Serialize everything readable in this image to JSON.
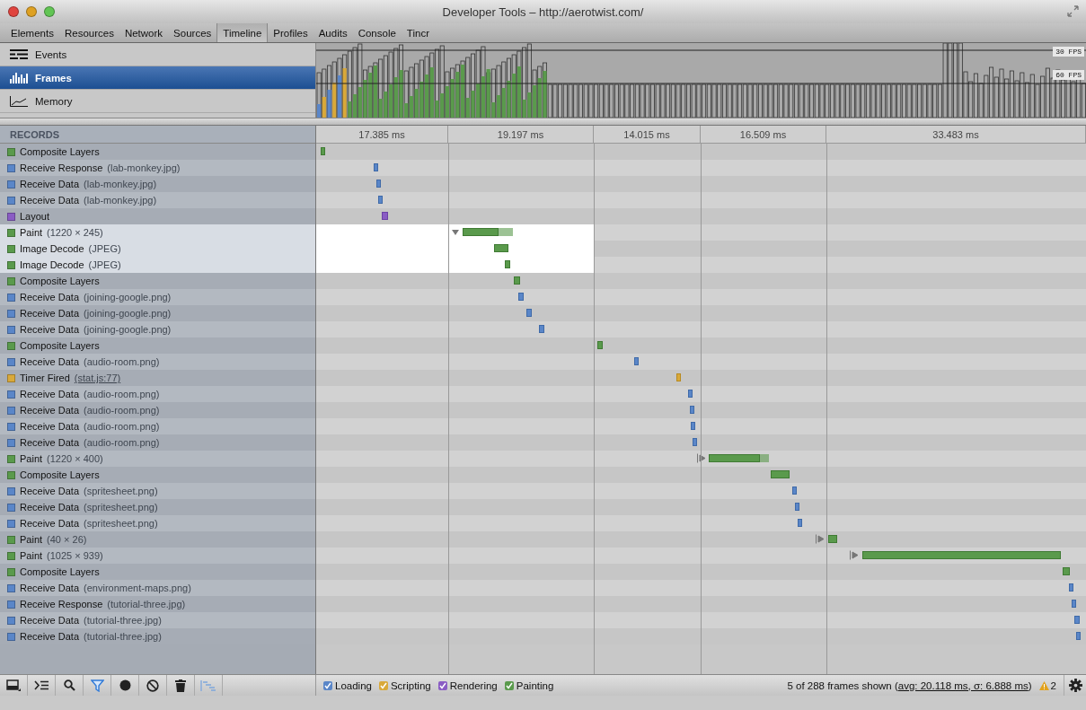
{
  "window": {
    "title": "Developer Tools – http://aerotwist.com/"
  },
  "tabs": [
    {
      "label": "Elements",
      "selected": false
    },
    {
      "label": "Resources",
      "selected": false
    },
    {
      "label": "Network",
      "selected": false
    },
    {
      "label": "Sources",
      "selected": false
    },
    {
      "label": "Timeline",
      "selected": true
    },
    {
      "label": "Profiles",
      "selected": false
    },
    {
      "label": "Audits",
      "selected": false
    },
    {
      "label": "Console",
      "selected": false
    },
    {
      "label": "Tincr",
      "selected": false
    }
  ],
  "sidebar": {
    "items": [
      {
        "label": "Events",
        "kind": "events",
        "selected": false
      },
      {
        "label": "Frames",
        "kind": "frames",
        "selected": true
      },
      {
        "label": "Memory",
        "kind": "memory",
        "selected": false
      }
    ]
  },
  "overview": {
    "fps_labels": [
      "30 FPS",
      "60 FPS"
    ]
  },
  "records_header": "RECORDS",
  "frame_columns": [
    "17.385 ms",
    "19.197 ms",
    "14.015 ms",
    "16.509 ms",
    "33.483 ms"
  ],
  "records": [
    {
      "name": "Composite Layers",
      "kind": "painting",
      "selected": false
    },
    {
      "name": "Receive Response",
      "detail": "(lab-monkey.jpg)",
      "kind": "loading",
      "selected": false
    },
    {
      "name": "Receive Data",
      "detail": "(lab-monkey.jpg)",
      "kind": "loading",
      "selected": false
    },
    {
      "name": "Receive Data",
      "detail": "(lab-monkey.jpg)",
      "kind": "loading",
      "selected": false
    },
    {
      "name": "Layout",
      "kind": "rendering",
      "selected": false
    },
    {
      "name": "Paint",
      "detail": "(1220 × 245)",
      "kind": "painting",
      "selected": true,
      "expanded": true,
      "children": [
        {
          "name": "Image Decode",
          "detail": "(JPEG)",
          "kind": "painting",
          "selected": true
        },
        {
          "name": "Image Decode",
          "detail": "(JPEG)",
          "kind": "painting",
          "selected": true
        }
      ]
    },
    {
      "name": "Composite Layers",
      "kind": "painting",
      "selected": false
    },
    {
      "name": "Receive Data",
      "detail": "(joining-google.png)",
      "kind": "loading",
      "selected": false
    },
    {
      "name": "Receive Data",
      "detail": "(joining-google.png)",
      "kind": "loading",
      "selected": false
    },
    {
      "name": "Receive Data",
      "detail": "(joining-google.png)",
      "kind": "loading",
      "selected": false
    },
    {
      "name": "Composite Layers",
      "kind": "painting",
      "selected": false
    },
    {
      "name": "Receive Data",
      "detail": "(audio-room.png)",
      "kind": "loading",
      "selected": false
    },
    {
      "name": "Timer Fired",
      "link": "(stat.js:77)",
      "kind": "scripting",
      "selected": false
    },
    {
      "name": "Receive Data",
      "detail": "(audio-room.png)",
      "kind": "loading",
      "selected": false
    },
    {
      "name": "Receive Data",
      "detail": "(audio-room.png)",
      "kind": "loading",
      "selected": false
    },
    {
      "name": "Receive Data",
      "detail": "(audio-room.png)",
      "kind": "loading",
      "selected": false
    },
    {
      "name": "Receive Data",
      "detail": "(audio-room.png)",
      "kind": "loading",
      "selected": false
    },
    {
      "name": "Paint",
      "detail": "(1220 × 400)",
      "kind": "painting",
      "selected": false,
      "expanded": false
    },
    {
      "name": "Composite Layers",
      "kind": "painting",
      "selected": false
    },
    {
      "name": "Receive Data",
      "detail": "(spritesheet.png)",
      "kind": "loading",
      "selected": false
    },
    {
      "name": "Receive Data",
      "detail": "(spritesheet.png)",
      "kind": "loading",
      "selected": false
    },
    {
      "name": "Receive Data",
      "detail": "(spritesheet.png)",
      "kind": "loading",
      "selected": false
    },
    {
      "name": "Paint",
      "detail": "(40 × 26)",
      "kind": "painting",
      "selected": false,
      "expanded": false
    },
    {
      "name": "Paint",
      "detail": "(1025 × 939)",
      "kind": "painting",
      "selected": false,
      "expanded": false
    },
    {
      "name": "Composite Layers",
      "kind": "painting",
      "selected": false
    },
    {
      "name": "Receive Data",
      "detail": "(environment-maps.png)",
      "kind": "loading",
      "selected": false
    },
    {
      "name": "Receive Response",
      "detail": "(tutorial-three.jpg)",
      "kind": "loading",
      "selected": false
    },
    {
      "name": "Receive Data",
      "detail": "(tutorial-three.jpg)",
      "kind": "loading",
      "selected": false
    },
    {
      "name": "Receive Data",
      "detail": "(tutorial-three.jpg)",
      "kind": "loading",
      "selected": false
    }
  ],
  "legend": [
    {
      "label": "Loading",
      "checked": true,
      "color": "#5a86c8"
    },
    {
      "label": "Scripting",
      "checked": true,
      "color": "#d9a93a"
    },
    {
      "label": "Rendering",
      "checked": true,
      "color": "#8a5cc4"
    },
    {
      "label": "Painting",
      "checked": true,
      "color": "#5a9a4c"
    }
  ],
  "status": {
    "text": "5 of 288 frames shown (",
    "link": "avg: 20.118 ms, σ: 6.888 ms",
    "close": ")",
    "warnings": "2"
  },
  "toolbar": {
    "filter_on": true
  }
}
